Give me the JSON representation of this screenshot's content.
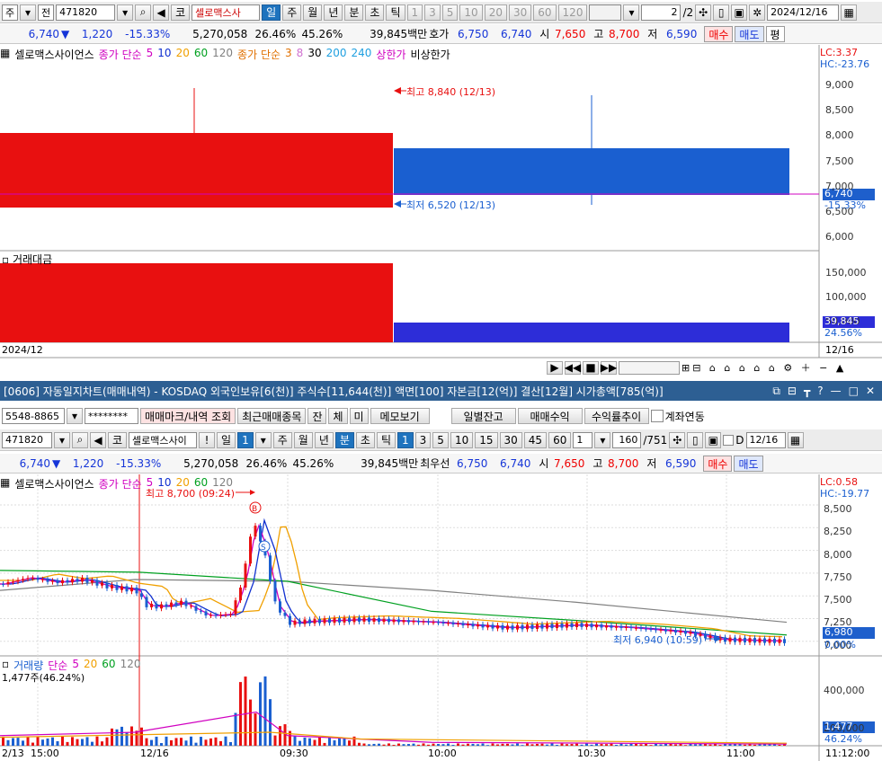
{
  "top": {
    "toolbar1": {
      "ju": "주",
      "jeon": "전",
      "code": "471820",
      "market": "코",
      "name": "셀로맥스사",
      "periods": [
        "일",
        "주",
        "월",
        "년",
        "분",
        "초",
        "틱"
      ],
      "active_period": "일",
      "nums": [
        "1",
        "3",
        "5",
        "10",
        "20",
        "30",
        "60",
        "120"
      ],
      "page": "2",
      "page_total": "/2",
      "date": "2024/12/16"
    },
    "quote": {
      "price": "6,740",
      "change": "1,220",
      "pct": "-15.33%",
      "volume": "5,270,058",
      "turn": "26.46%",
      "ratio": "45.26%",
      "amount": "39,845백만",
      "hoga_label": "호가",
      "ask": "6,750",
      "bid": "6,740",
      "open_label": "시",
      "open": "7,650",
      "high_label": "고",
      "high": "8,700",
      "low_label": "저",
      "low": "6,590",
      "buy": "매수",
      "sell": "매도",
      "flat": "평"
    },
    "legend": {
      "name": "셀로맥스사이언스",
      "ma1_label": "종가 단순",
      "ma1": [
        "5",
        "10",
        "20",
        "60",
        "120"
      ],
      "ma2_label": "종가 단순",
      "ma2": [
        "3",
        "8",
        "30",
        "200",
        "240"
      ],
      "upper": "상한가",
      "vi": "비상한가"
    },
    "lc": "LC:3.37",
    "hc": "HC:-23.76",
    "price_ticks": [
      "9,000",
      "8,500",
      "8,000",
      "7,500",
      "7,000",
      "6,500",
      "6,000"
    ],
    "hi_note": "최고 8,840 (12/13)",
    "lo_note": "최저 6,520 (12/13)",
    "cur_price": "6,740",
    "cur_pct": "-15.33%",
    "vol_title": "거래대금",
    "vol_ticks": [
      "150,000",
      "100,000",
      "50,000"
    ],
    "vol_cur": "39,845",
    "vol_pct": "24.56%",
    "date_left": "2024/12",
    "date_right": "12/16"
  },
  "window": {
    "title": "[0606] 자동일지차트(매매내역) - KOSDAQ 외국인보유[6(천)] 주식수[11,644(천)] 액면[100] 자본금[12(억)] 결산[12월] 시가총액[785(억)]"
  },
  "bottom": {
    "acct": {
      "account": "5548-8865",
      "password": "********",
      "btn_mark": "매매마크/내역 조회",
      "btn_recent": "최근매매종목",
      "jan": "잔",
      "che": "체",
      "mi": "미",
      "memo": "메모보기",
      "daily": "일별잔고",
      "profit": "매매수익",
      "rate": "수익률추이",
      "acct_link": "계좌연동"
    },
    "toolbar": {
      "code": "471820",
      "market": "코",
      "name": "셀로맥스사이",
      "day": "일",
      "interval": "1",
      "periods": [
        "주",
        "월",
        "년",
        "분",
        "초",
        "틱"
      ],
      "active_period": "분",
      "nums": [
        "1",
        "3",
        "5",
        "10",
        "15",
        "30",
        "45",
        "60"
      ],
      "sel": "1",
      "count": "160",
      "count_total": "/751",
      "d_label": "D",
      "date": "12/16"
    },
    "quote": {
      "price": "6,740",
      "change": "1,220",
      "pct": "-15.33%",
      "volume": "5,270,058",
      "turn": "26.46%",
      "ratio": "45.26%",
      "amount": "39,845백만",
      "hoga_label": "최우선",
      "ask": "6,750",
      "bid": "6,740",
      "open_label": "시",
      "open": "7,650",
      "high_label": "고",
      "high": "8,700",
      "low_label": "저",
      "low": "6,590",
      "buy": "매수",
      "sell": "매도"
    },
    "legend": {
      "name": "셀로맥스사이언스",
      "ma_label": "종가 단순",
      "ma": [
        "5",
        "10",
        "20",
        "60",
        "120"
      ]
    },
    "lc": "LC:0.58",
    "hc": "HC:-19.77",
    "price_ticks": [
      "8,500",
      "8,250",
      "8,000",
      "7,750",
      "7,500",
      "7,250",
      "7,000"
    ],
    "hi_note": "최고 8,700 (09:24)",
    "lo_note": "최저 6,940 (10:59)",
    "cur_price": "6,980",
    "cur_pct": "0.00%",
    "vol_legend": {
      "title": "거래량",
      "ma_label": "단순",
      "ma": [
        "5",
        "20",
        "60",
        "120"
      ],
      "sub": "1,477주(46.24%)"
    },
    "vol_ticks": [
      "400,000",
      "200,000"
    ],
    "vol_cur": "1,477",
    "vol_pct": "46.24%",
    "time_ticks": [
      "2/13",
      "15:00",
      "12/16",
      "09:30",
      "10:00",
      "10:30",
      "11:00",
      "11:12:00"
    ]
  },
  "colors": {
    "up": "#e81010",
    "down": "#1a5fd0",
    "vol_down": "#2d2dd8",
    "accent": "#1e73be",
    "ma5": "#d000c0",
    "ma10": "#1030d0",
    "ma20": "#f0a000",
    "ma60": "#00a020",
    "ma120": "#808080"
  }
}
